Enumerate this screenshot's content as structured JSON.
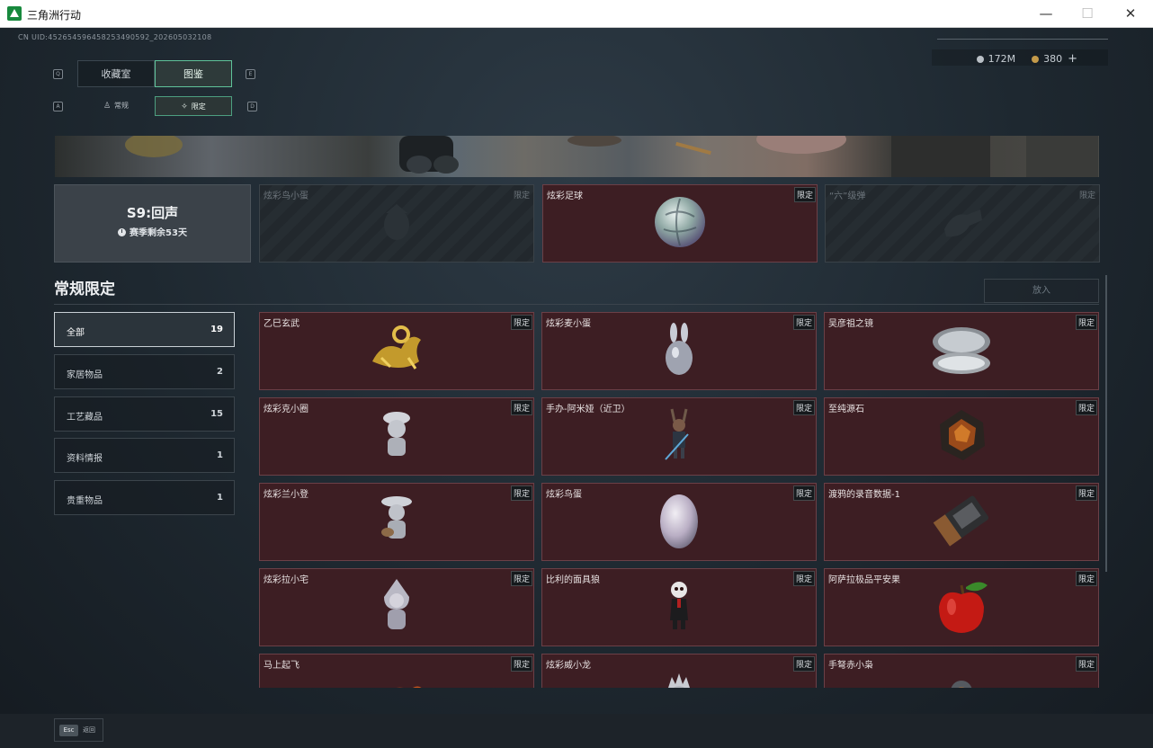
{
  "window": {
    "title": "三角洲行动",
    "minimize": "—",
    "maximize": "☐",
    "close": "✕"
  },
  "uid": "CN UID:452654596458253490592_202605032108",
  "currency": {
    "silver": "172M",
    "gold": "380",
    "add": "+"
  },
  "keys": {
    "q": "Q",
    "e": "E",
    "a": "A",
    "d": "D",
    "esc": "Esc"
  },
  "tabs": {
    "main": [
      {
        "label": "收藏室"
      },
      {
        "label": "图鉴"
      }
    ],
    "sub": [
      {
        "label": "常规"
      },
      {
        "label": "限定"
      }
    ]
  },
  "season": {
    "title": "S9:回声",
    "subtitle": "赛季剩余53天"
  },
  "featured": [
    {
      "name": "炫彩鸟小蛋",
      "tag": "限定",
      "locked": true
    },
    {
      "name": "炫彩足球",
      "tag": "限定",
      "locked": false
    },
    {
      "name": "“六”级弹",
      "tag": "限定",
      "locked": true
    }
  ],
  "section": {
    "title": "常规限定",
    "put_button": "放入"
  },
  "categories": [
    {
      "label": "全部",
      "count": "19"
    },
    {
      "label": "家居物品",
      "count": "2"
    },
    {
      "label": "工艺藏品",
      "count": "15"
    },
    {
      "label": "资料情报",
      "count": "1"
    },
    {
      "label": "贵重物品",
      "count": "1"
    }
  ],
  "items": [
    {
      "name": "乙巳玄武",
      "tag": "限定"
    },
    {
      "name": "炫彩麦小蛋",
      "tag": "限定"
    },
    {
      "name": "吴彦祖之镜",
      "tag": "限定"
    },
    {
      "name": "炫彩克小圈",
      "tag": "限定"
    },
    {
      "name": "手办-阿米娅（近卫）",
      "tag": "限定"
    },
    {
      "name": "至纯源石",
      "tag": "限定"
    },
    {
      "name": "炫彩兰小登",
      "tag": "限定"
    },
    {
      "name": "炫彩鸟蛋",
      "tag": "限定"
    },
    {
      "name": "渡鸦的录音数据-1",
      "tag": "限定"
    },
    {
      "name": "炫彩拉小宅",
      "tag": "限定"
    },
    {
      "name": "比利的面具狼",
      "tag": "限定"
    },
    {
      "name": "阿萨拉极品平安果",
      "tag": "限定"
    },
    {
      "name": "马上起飞",
      "tag": "限定"
    },
    {
      "name": "炫彩威小龙",
      "tag": "限定"
    },
    {
      "name": "手弩赤小枭",
      "tag": "限定"
    }
  ],
  "footer": {
    "back": "返回"
  },
  "colors": {
    "accent": "#5fc39a",
    "card_bg": "#3d1e23",
    "card_border": "#6b4047"
  }
}
